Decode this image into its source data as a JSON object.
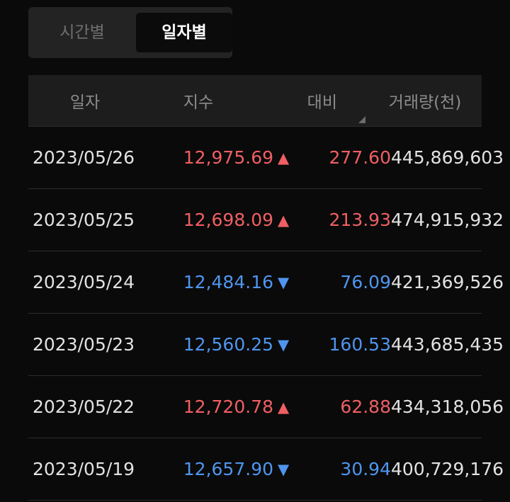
{
  "tabs": [
    {
      "label": "시간별",
      "active": false
    },
    {
      "label": "일자별",
      "active": true
    }
  ],
  "table": {
    "headers": {
      "date": "일자",
      "index": "지수",
      "change": "대비",
      "volume": "거래량(천)"
    },
    "rows": [
      {
        "date": "2023/05/26",
        "index": "12,975.69",
        "arrow": "▲",
        "direction": "up",
        "change": "277.60",
        "volume": "445,869,603"
      },
      {
        "date": "2023/05/25",
        "index": "12,698.09",
        "arrow": "▲",
        "direction": "up",
        "change": "213.93",
        "volume": "474,915,932"
      },
      {
        "date": "2023/05/24",
        "index": "12,484.16",
        "arrow": "▼",
        "direction": "down",
        "change": "76.09",
        "volume": "421,369,526"
      },
      {
        "date": "2023/05/23",
        "index": "12,560.25",
        "arrow": "▼",
        "direction": "down",
        "change": "160.53",
        "volume": "443,685,435"
      },
      {
        "date": "2023/05/22",
        "index": "12,720.78",
        "arrow": "▲",
        "direction": "up",
        "change": "62.88",
        "volume": "434,318,056"
      },
      {
        "date": "2023/05/19",
        "index": "12,657.90",
        "arrow": "▼",
        "direction": "down",
        "change": "30.94",
        "volume": "400,729,176"
      }
    ]
  },
  "colors": {
    "up": "#ef5f63",
    "down": "#4f95ee",
    "background": "#0a0a0a"
  }
}
